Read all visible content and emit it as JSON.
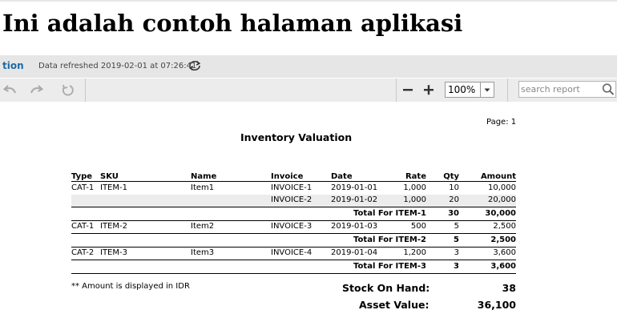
{
  "page_title": "Ini adalah contoh halaman aplikasi",
  "toolbar": {
    "app_tab": "tion",
    "refreshed_text": "Data refreshed 2019-02-01 at 07:26:41",
    "zoom_value": "100%",
    "search_placeholder": "search report"
  },
  "report": {
    "page_label": "Page: 1",
    "title": "Inventory Valuation",
    "columns": {
      "type": "Type",
      "sku": "SKU",
      "name": "Name",
      "invoice": "Invoice",
      "date": "Date",
      "rate": "Rate",
      "qty": "Qty",
      "amount": "Amount"
    },
    "rows": [
      {
        "kind": "line",
        "type": "CAT-1",
        "sku": "ITEM-1",
        "name": "Item1",
        "invoice": "INVOICE-1",
        "date": "2019-01-01",
        "rate": "1,000",
        "qty": "10",
        "amount": "10,000"
      },
      {
        "kind": "line",
        "type": "",
        "sku": "",
        "name": "",
        "invoice": "INVOICE-2",
        "date": "2019-01-02",
        "rate": "1,000",
        "qty": "20",
        "amount": "20,000"
      },
      {
        "kind": "total",
        "label": "Total For ITEM-1",
        "qty": "30",
        "amount": "30,000"
      },
      {
        "kind": "line",
        "type": "CAT-1",
        "sku": "ITEM-2",
        "name": "Item2",
        "invoice": "INVOICE-3",
        "date": "2019-01-03",
        "rate": "500",
        "qty": "5",
        "amount": "2,500"
      },
      {
        "kind": "total",
        "label": "Total For ITEM-2",
        "qty": "5",
        "amount": "2,500"
      },
      {
        "kind": "line",
        "type": "CAT-2",
        "sku": "ITEM-3",
        "name": "Item3",
        "invoice": "INVOICE-4",
        "date": "2019-01-04",
        "rate": "1,200",
        "qty": "3",
        "amount": "3,600"
      },
      {
        "kind": "total",
        "label": "Total For ITEM-3",
        "qty": "3",
        "amount": "3,600"
      }
    ],
    "footnote": "** Amount is displayed in IDR",
    "stock_on_hand_label": "Stock On Hand:",
    "stock_on_hand_value": "38",
    "asset_value_label": "Asset Value:",
    "asset_value_value": "36,100"
  },
  "icons": [
    "refresh-icon",
    "undo-icon",
    "redo-icon",
    "reset-icon",
    "zoom-out-icon",
    "zoom-in-icon",
    "chevron-down-icon",
    "search-icon"
  ]
}
